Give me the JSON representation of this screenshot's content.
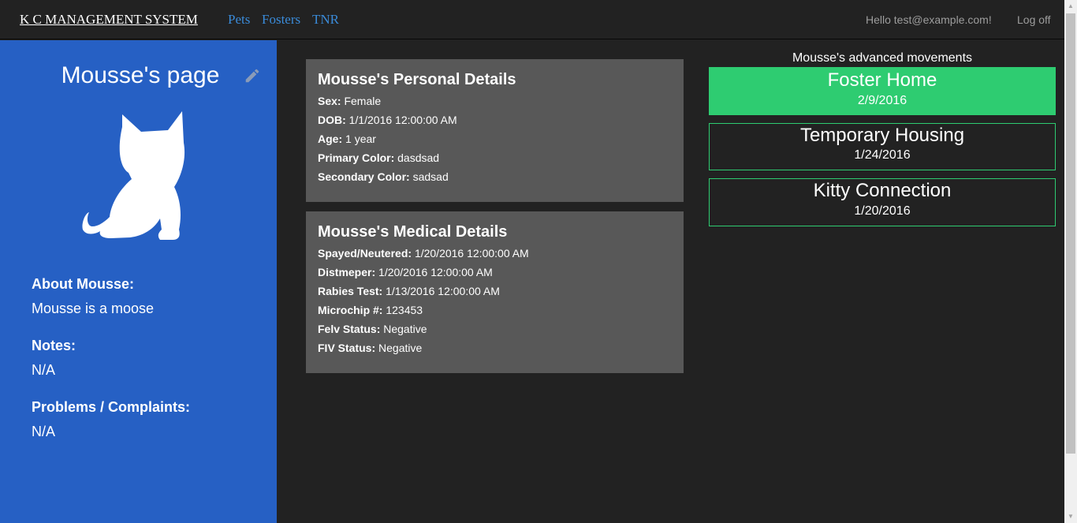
{
  "nav": {
    "brand": "K C MANAGEMENT SYSTEM",
    "links": [
      "Pets",
      "Fosters",
      "TNR"
    ],
    "greeting": "Hello test@example.com!",
    "logoff": "Log off"
  },
  "sidebar": {
    "title": "Mousse's page",
    "about_label": "About Mousse:",
    "about_value": "Mousse is a moose",
    "notes_label": "Notes:",
    "notes_value": "N/A",
    "problems_label": "Problems / Complaints:",
    "problems_value": "N/A"
  },
  "personal": {
    "title": "Mousse's Personal Details",
    "rows": [
      {
        "label": "Sex:",
        "value": "Female"
      },
      {
        "label": "DOB:",
        "value": "1/1/2016 12:00:00 AM"
      },
      {
        "label": "Age:",
        "value": "1 year"
      },
      {
        "label": "Primary Color:",
        "value": "dasdsad"
      },
      {
        "label": "Secondary Color:",
        "value": "sadsad"
      }
    ]
  },
  "medical": {
    "title": "Mousse's Medical Details",
    "rows": [
      {
        "label": "Spayed/Neutered:",
        "value": "1/20/2016 12:00:00 AM"
      },
      {
        "label": "Distmeper:",
        "value": "1/20/2016 12:00:00 AM"
      },
      {
        "label": "Rabies Test:",
        "value": "1/13/2016 12:00:00 AM"
      },
      {
        "label": "Microchip #:",
        "value": "123453"
      },
      {
        "label": "Felv Status:",
        "value": "Negative"
      },
      {
        "label": "FIV Status:",
        "value": "Negative"
      }
    ]
  },
  "movements": {
    "title": "Mousse's advanced movements",
    "items": [
      {
        "name": "Foster Home",
        "date": "2/9/2016"
      },
      {
        "name": "Temporary Housing",
        "date": "1/24/2016"
      },
      {
        "name": "Kitty Connection",
        "date": "1/20/2016"
      }
    ]
  },
  "colors": {
    "sidebar": "#2660c4",
    "card": "#585858",
    "accent_green": "#2ecc71",
    "link_blue": "#3a8bd9"
  },
  "icons": {
    "edit": "pencil-icon",
    "pet": "cat-silhouette-icon"
  }
}
